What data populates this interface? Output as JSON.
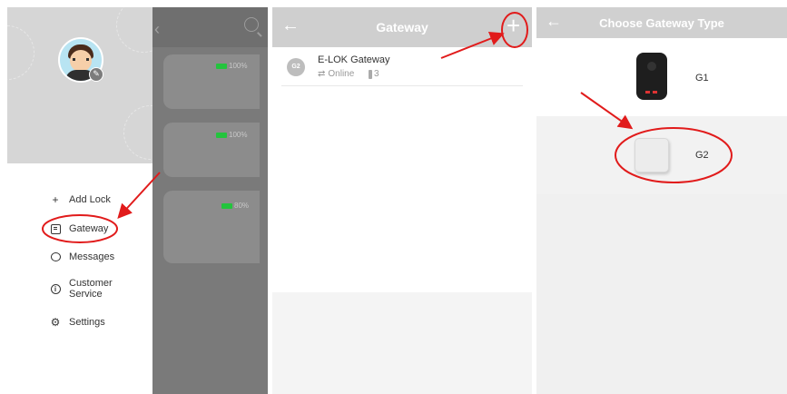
{
  "panel1": {
    "menu": {
      "items": [
        {
          "label": "Add Lock",
          "icon": "plus-icon"
        },
        {
          "label": "Gateway",
          "icon": "gateway-icon"
        },
        {
          "label": "Messages",
          "icon": "chat-icon"
        },
        {
          "label": "Customer\nService",
          "icon": "info-icon"
        },
        {
          "label": "Settings",
          "icon": "gear-icon"
        }
      ]
    },
    "background_cards": [
      {
        "battery": "100%"
      },
      {
        "battery": "100%"
      },
      {
        "battery": "80%"
      }
    ]
  },
  "panel2": {
    "title": "Gateway",
    "gateway": {
      "name": "E-LOK Gateway",
      "status": "Online",
      "lock_count": "3",
      "badge": "G2"
    }
  },
  "panel3": {
    "title": "Choose Gateway Type",
    "options": [
      {
        "label": "G1"
      },
      {
        "label": "G2"
      }
    ]
  },
  "colors": {
    "annotation_red": "#e11b1b",
    "battery_green": "#23c43d"
  }
}
